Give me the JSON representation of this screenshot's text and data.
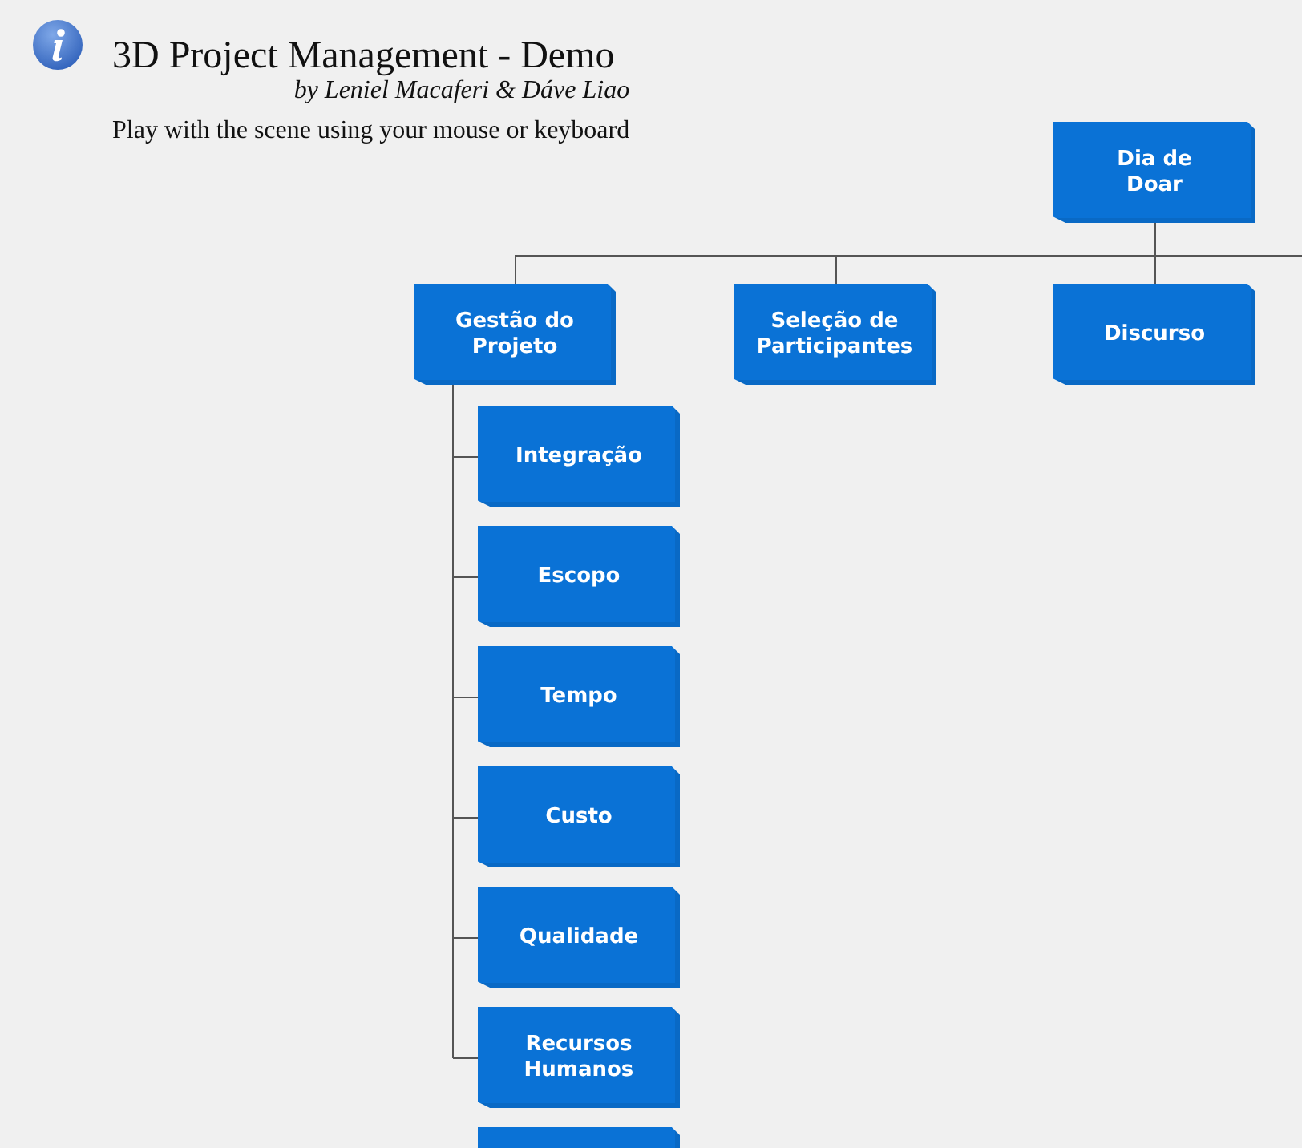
{
  "header": {
    "title": "3D Project Management - Demo",
    "byline": "by Leniel Macaferi & Dáve Liao",
    "instructions": "Play with the scene using your mouse or keyboard"
  },
  "chart": {
    "root": {
      "label": "Dia de\nDoar",
      "children": [
        {
          "kind": "node",
          "label": "Gestão do\nProjeto",
          "children": [
            {
              "kind": "node",
              "label": "Integração"
            },
            {
              "kind": "node",
              "label": "Escopo"
            },
            {
              "kind": "node",
              "label": "Tempo"
            },
            {
              "kind": "node",
              "label": "Custo"
            },
            {
              "kind": "node",
              "label": "Qualidade"
            },
            {
              "kind": "node",
              "label": "Recursos\nHumanos"
            },
            {
              "kind": "cut-off"
            }
          ]
        },
        {
          "kind": "node",
          "label": "Seleção de\nParticipantes"
        },
        {
          "kind": "node",
          "label": "Discurso"
        }
      ]
    }
  }
}
